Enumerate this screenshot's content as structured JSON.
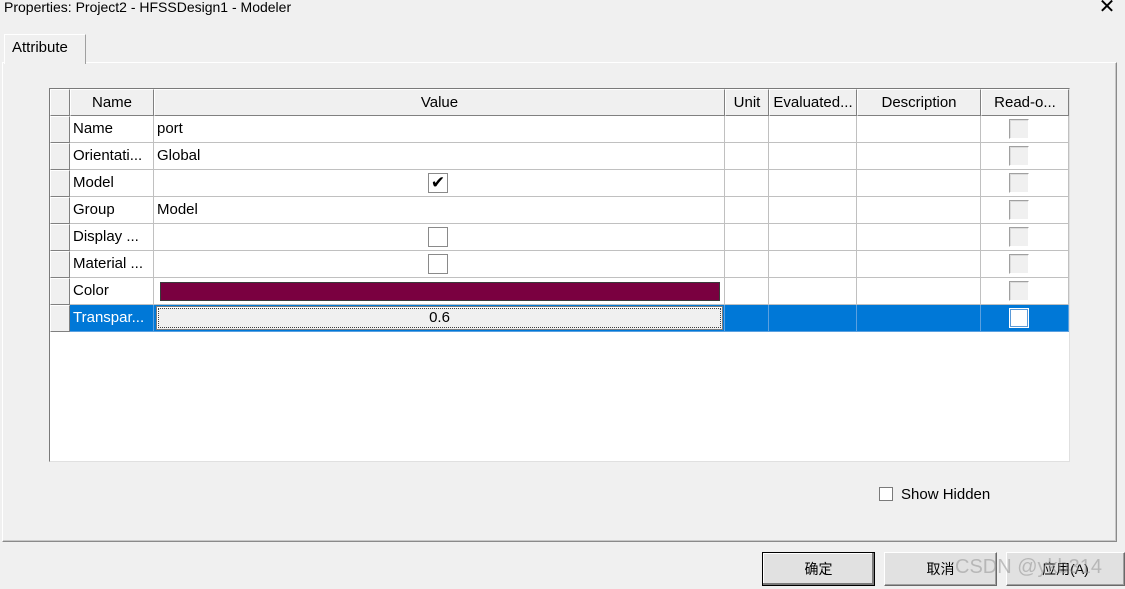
{
  "window": {
    "title": "Properties: Project2 - HFSSDesign1 - Modeler",
    "close_symbol": "✕"
  },
  "tabs": [
    {
      "label": "Attribute"
    }
  ],
  "table": {
    "columns": [
      "Name",
      "Value",
      "Unit",
      "Evaluated...",
      "Description",
      "Read-o..."
    ],
    "rows": [
      {
        "name": "Name",
        "value": "port",
        "value_type": "text"
      },
      {
        "name": "Orientati...",
        "value": "Global",
        "value_type": "text"
      },
      {
        "name": "Model",
        "value": "",
        "value_type": "checkbox",
        "checked": true,
        "check_glyph": "✔"
      },
      {
        "name": "Group",
        "value": "Model",
        "value_type": "text"
      },
      {
        "name": "Display ...",
        "value": "",
        "value_type": "checkbox",
        "checked": false,
        "check_glyph": ""
      },
      {
        "name": "Material ...",
        "value": "",
        "value_type": "checkbox",
        "checked": false,
        "check_glyph": ""
      },
      {
        "name": "Color",
        "value": "",
        "value_type": "color",
        "color": "#7a0040"
      },
      {
        "name": "Transpar...",
        "value": "0.6",
        "value_type": "edit",
        "selected": true
      }
    ]
  },
  "show_hidden": {
    "label": "Show Hidden",
    "checked": false
  },
  "buttons": {
    "ok": "确定",
    "cancel": "取消",
    "apply": "应用(A)"
  },
  "watermark": "CSDN @ykb314",
  "colors": {
    "selection": "#0078d7",
    "model_color": "#7a0040"
  }
}
